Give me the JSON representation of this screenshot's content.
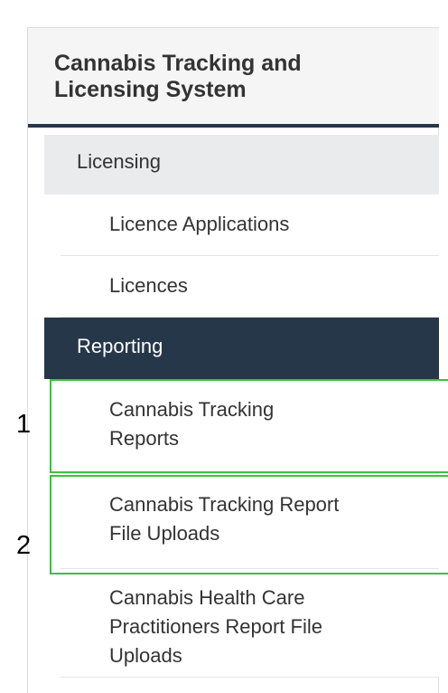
{
  "header": {
    "title_line1": "Cannabis Tracking and",
    "title_line2": "Licensing System"
  },
  "menu": {
    "licensing": {
      "label": "Licensing",
      "items": [
        {
          "label": "Licence Applications"
        },
        {
          "label": "Licences"
        }
      ]
    },
    "reporting": {
      "label": "Reporting",
      "items": [
        {
          "label_line1": "Cannabis Tracking",
          "label_line2": "Reports"
        },
        {
          "label_line1": "Cannabis Tracking Report",
          "label_line2": "File Uploads"
        },
        {
          "label_line1": "Cannabis Health Care",
          "label_line2": "Practitioners Report File",
          "label_line3": "Uploads"
        }
      ]
    }
  },
  "annotations": {
    "callout_1": "1",
    "callout_2": "2",
    "highlight_color": "#3cc13c"
  },
  "colors": {
    "active_section_bg": "#26374a",
    "section_bg": "#eaebed",
    "header_underline": "#26374a"
  }
}
